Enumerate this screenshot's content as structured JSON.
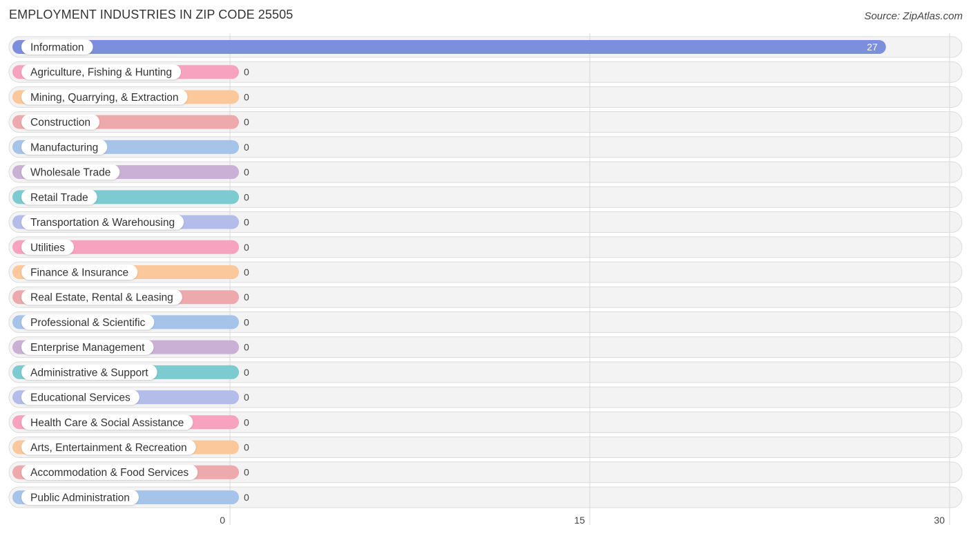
{
  "header": {
    "title": "EMPLOYMENT INDUSTRIES IN ZIP CODE 25505",
    "source": "Source: ZipAtlas.com"
  },
  "chart_data": {
    "type": "bar",
    "orientation": "horizontal",
    "title": "EMPLOYMENT INDUSTRIES IN ZIP CODE 25505",
    "xlabel": "",
    "ylabel": "",
    "xlim": [
      0,
      30
    ],
    "xticks": [
      0,
      15,
      30
    ],
    "grid": true,
    "categories": [
      "Information",
      "Agriculture, Fishing & Hunting",
      "Mining, Quarrying, & Extraction",
      "Construction",
      "Manufacturing",
      "Wholesale Trade",
      "Retail Trade",
      "Transportation & Warehousing",
      "Utilities",
      "Finance & Insurance",
      "Real Estate, Rental & Leasing",
      "Professional & Scientific",
      "Enterprise Management",
      "Administrative & Support",
      "Educational Services",
      "Health Care & Social Assistance",
      "Arts, Entertainment & Recreation",
      "Accommodation & Food Services",
      "Public Administration"
    ],
    "values": [
      27,
      0,
      0,
      0,
      0,
      0,
      0,
      0,
      0,
      0,
      0,
      0,
      0,
      0,
      0,
      0,
      0,
      0,
      0
    ],
    "colors": [
      "#7b8fdc",
      "#f7a3bf",
      "#fbc89b",
      "#eda9ac",
      "#a6c4ea",
      "#c9b0d4",
      "#7ccbd1",
      "#b4bdea",
      "#f7a3bf",
      "#fbc89b",
      "#eda9ac",
      "#a6c4ea",
      "#c9b0d4",
      "#7ccbd1",
      "#b4bdea",
      "#f7a3bf",
      "#fbc89b",
      "#eda9ac",
      "#a6c4ea"
    ]
  }
}
